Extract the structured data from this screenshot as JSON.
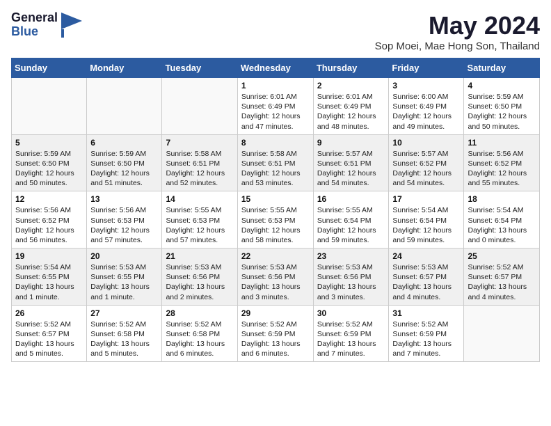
{
  "header": {
    "logo_general": "General",
    "logo_blue": "Blue",
    "title": "May 2024",
    "location": "Sop Moei, Mae Hong Son, Thailand"
  },
  "days_of_week": [
    "Sunday",
    "Monday",
    "Tuesday",
    "Wednesday",
    "Thursday",
    "Friday",
    "Saturday"
  ],
  "weeks": [
    [
      {
        "day": "",
        "info": ""
      },
      {
        "day": "",
        "info": ""
      },
      {
        "day": "",
        "info": ""
      },
      {
        "day": "1",
        "info": "Sunrise: 6:01 AM\nSunset: 6:49 PM\nDaylight: 12 hours\nand 47 minutes."
      },
      {
        "day": "2",
        "info": "Sunrise: 6:01 AM\nSunset: 6:49 PM\nDaylight: 12 hours\nand 48 minutes."
      },
      {
        "day": "3",
        "info": "Sunrise: 6:00 AM\nSunset: 6:49 PM\nDaylight: 12 hours\nand 49 minutes."
      },
      {
        "day": "4",
        "info": "Sunrise: 5:59 AM\nSunset: 6:50 PM\nDaylight: 12 hours\nand 50 minutes."
      }
    ],
    [
      {
        "day": "5",
        "info": "Sunrise: 5:59 AM\nSunset: 6:50 PM\nDaylight: 12 hours\nand 50 minutes."
      },
      {
        "day": "6",
        "info": "Sunrise: 5:59 AM\nSunset: 6:50 PM\nDaylight: 12 hours\nand 51 minutes."
      },
      {
        "day": "7",
        "info": "Sunrise: 5:58 AM\nSunset: 6:51 PM\nDaylight: 12 hours\nand 52 minutes."
      },
      {
        "day": "8",
        "info": "Sunrise: 5:58 AM\nSunset: 6:51 PM\nDaylight: 12 hours\nand 53 minutes."
      },
      {
        "day": "9",
        "info": "Sunrise: 5:57 AM\nSunset: 6:51 PM\nDaylight: 12 hours\nand 54 minutes."
      },
      {
        "day": "10",
        "info": "Sunrise: 5:57 AM\nSunset: 6:52 PM\nDaylight: 12 hours\nand 54 minutes."
      },
      {
        "day": "11",
        "info": "Sunrise: 5:56 AM\nSunset: 6:52 PM\nDaylight: 12 hours\nand 55 minutes."
      }
    ],
    [
      {
        "day": "12",
        "info": "Sunrise: 5:56 AM\nSunset: 6:52 PM\nDaylight: 12 hours\nand 56 minutes."
      },
      {
        "day": "13",
        "info": "Sunrise: 5:56 AM\nSunset: 6:53 PM\nDaylight: 12 hours\nand 57 minutes."
      },
      {
        "day": "14",
        "info": "Sunrise: 5:55 AM\nSunset: 6:53 PM\nDaylight: 12 hours\nand 57 minutes."
      },
      {
        "day": "15",
        "info": "Sunrise: 5:55 AM\nSunset: 6:53 PM\nDaylight: 12 hours\nand 58 minutes."
      },
      {
        "day": "16",
        "info": "Sunrise: 5:55 AM\nSunset: 6:54 PM\nDaylight: 12 hours\nand 59 minutes."
      },
      {
        "day": "17",
        "info": "Sunrise: 5:54 AM\nSunset: 6:54 PM\nDaylight: 12 hours\nand 59 minutes."
      },
      {
        "day": "18",
        "info": "Sunrise: 5:54 AM\nSunset: 6:54 PM\nDaylight: 13 hours\nand 0 minutes."
      }
    ],
    [
      {
        "day": "19",
        "info": "Sunrise: 5:54 AM\nSunset: 6:55 PM\nDaylight: 13 hours\nand 1 minute."
      },
      {
        "day": "20",
        "info": "Sunrise: 5:53 AM\nSunset: 6:55 PM\nDaylight: 13 hours\nand 1 minute."
      },
      {
        "day": "21",
        "info": "Sunrise: 5:53 AM\nSunset: 6:56 PM\nDaylight: 13 hours\nand 2 minutes."
      },
      {
        "day": "22",
        "info": "Sunrise: 5:53 AM\nSunset: 6:56 PM\nDaylight: 13 hours\nand 3 minutes."
      },
      {
        "day": "23",
        "info": "Sunrise: 5:53 AM\nSunset: 6:56 PM\nDaylight: 13 hours\nand 3 minutes."
      },
      {
        "day": "24",
        "info": "Sunrise: 5:53 AM\nSunset: 6:57 PM\nDaylight: 13 hours\nand 4 minutes."
      },
      {
        "day": "25",
        "info": "Sunrise: 5:52 AM\nSunset: 6:57 PM\nDaylight: 13 hours\nand 4 minutes."
      }
    ],
    [
      {
        "day": "26",
        "info": "Sunrise: 5:52 AM\nSunset: 6:57 PM\nDaylight: 13 hours\nand 5 minutes."
      },
      {
        "day": "27",
        "info": "Sunrise: 5:52 AM\nSunset: 6:58 PM\nDaylight: 13 hours\nand 5 minutes."
      },
      {
        "day": "28",
        "info": "Sunrise: 5:52 AM\nSunset: 6:58 PM\nDaylight: 13 hours\nand 6 minutes."
      },
      {
        "day": "29",
        "info": "Sunrise: 5:52 AM\nSunset: 6:59 PM\nDaylight: 13 hours\nand 6 minutes."
      },
      {
        "day": "30",
        "info": "Sunrise: 5:52 AM\nSunset: 6:59 PM\nDaylight: 13 hours\nand 7 minutes."
      },
      {
        "day": "31",
        "info": "Sunrise: 5:52 AM\nSunset: 6:59 PM\nDaylight: 13 hours\nand 7 minutes."
      },
      {
        "day": "",
        "info": ""
      }
    ]
  ]
}
